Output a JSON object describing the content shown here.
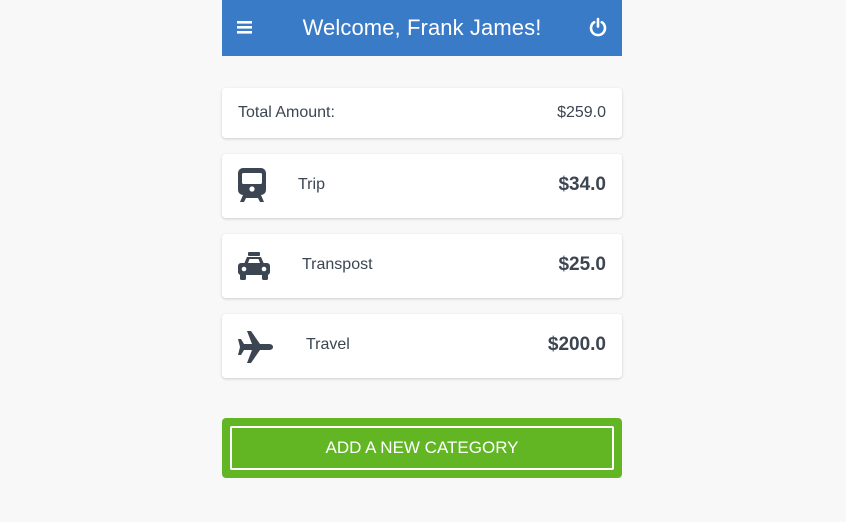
{
  "header": {
    "title": "Welcome, Frank James!",
    "menu_icon": "menu-icon",
    "power_icon": "power-icon",
    "bg_color": "#3a7bc8"
  },
  "summary": {
    "label": "Total Amount:",
    "value": "$259.0"
  },
  "categories": [
    {
      "name": "Trip",
      "amount": "$34.0",
      "icon": "train-icon"
    },
    {
      "name": "Transpost",
      "amount": "$25.0",
      "icon": "taxi-icon"
    },
    {
      "name": "Travel",
      "amount": "$200.0",
      "icon": "airplane-icon"
    }
  ],
  "actions": {
    "add_category_label": "ADD A NEW CATEGORY",
    "add_category_color": "#62b623"
  }
}
